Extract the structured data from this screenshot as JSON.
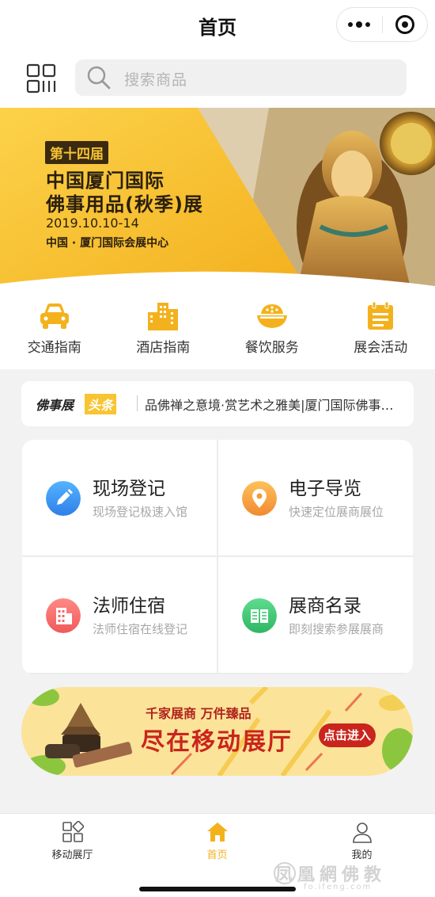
{
  "header": {
    "title": "首页"
  },
  "search": {
    "placeholder": "搜索商品"
  },
  "banner": {
    "edition": "第十四届",
    "line1": "中国厦门国际",
    "line2": "佛事用品(秋季)展",
    "date": "2019.10.10-14",
    "venue": "中国 · 厦门国际会展中心"
  },
  "quick_links": [
    {
      "label": "交通指南",
      "icon": "car-icon"
    },
    {
      "label": "酒店指南",
      "icon": "building-icon"
    },
    {
      "label": "餐饮服务",
      "icon": "rice-bowl-icon"
    },
    {
      "label": "展会活动",
      "icon": "calendar-icon"
    }
  ],
  "news": {
    "tag_main": "佛事展",
    "tag_highlight": "头条",
    "text": "品佛禅之意境·赏艺术之雅美|厦门国际佛事用品展"
  },
  "services": [
    {
      "title": "现场登记",
      "subtitle": "现场登记极速入馆",
      "icon": "pencil-icon",
      "color": "#3a8ef0"
    },
    {
      "title": "电子导览",
      "subtitle": "快速定位展商展位",
      "icon": "location-pin-icon",
      "color": "#f0903a"
    },
    {
      "title": "法师住宿",
      "subtitle": "法师住宿在线登记",
      "icon": "building-icon",
      "color": "#f05a5a"
    },
    {
      "title": "展商名录",
      "subtitle": "即刻搜索参展展商",
      "icon": "book-icon",
      "color": "#3cc270"
    }
  ],
  "promo": {
    "line1": "千家展商 万件臻品",
    "line2": "尽在移动展厅",
    "button": "点击进入"
  },
  "tabbar": [
    {
      "label": "移动展厅",
      "icon": "grid-icon",
      "active": false
    },
    {
      "label": "首页",
      "icon": "home-icon",
      "active": true
    },
    {
      "label": "我的",
      "icon": "user-icon",
      "active": false
    }
  ],
  "watermark": {
    "brand": "凤凰網佛教",
    "url": "fo.ifeng.com"
  },
  "colors": {
    "accent": "#f3b21d",
    "banner_yellow": "#f7c234",
    "promo_red": "#c9251c"
  }
}
